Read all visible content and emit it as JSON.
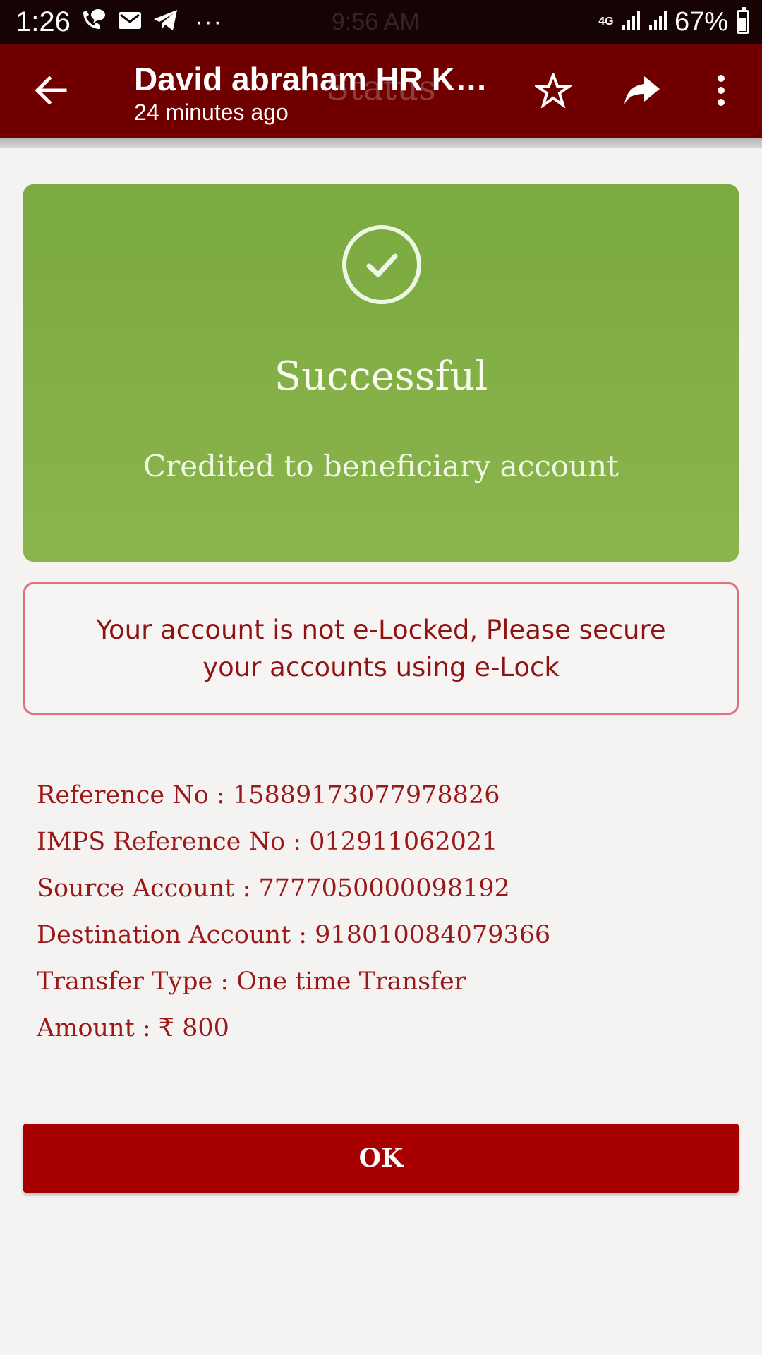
{
  "status_bar": {
    "time": "1:26",
    "background_time": "9:56 AM",
    "overflow": "···",
    "network": "4G",
    "battery": "67%",
    "battery_level": 0.67,
    "icons": [
      "phone-chat-icon",
      "mail-icon",
      "telegram-icon",
      "signal-icon",
      "signal-icon",
      "battery-icon"
    ]
  },
  "toolbar": {
    "title": "David abraham HR Kan…",
    "subtitle": "24 minutes ago",
    "background_title": "Status",
    "color": "#700000",
    "icons": [
      "back-arrow-icon",
      "star-icon",
      "share-icon",
      "more-vert-icon"
    ]
  },
  "success": {
    "title": "Successful",
    "subtitle": "Credited to beneficiary account",
    "color": "#87b24b",
    "icon": "check-circle-icon"
  },
  "warning": {
    "text": "Your account is not e-Locked, Please secure your accounts using e-Lock",
    "border_color": "#e0707a"
  },
  "details": [
    {
      "label": "Reference No",
      "value": "15889173077978826"
    },
    {
      "label": "IMPS Reference No",
      "value": "012911062021"
    },
    {
      "label": "Source Account",
      "value": "7777050000098192"
    },
    {
      "label": "Destination Account",
      "value": "918010084079366"
    },
    {
      "label": "Transfer Type",
      "value": "One time Transfer"
    },
    {
      "label": "Amount",
      "value": "₹ 800"
    }
  ],
  "ok_button": {
    "label": "OK",
    "color": "#a80000"
  }
}
